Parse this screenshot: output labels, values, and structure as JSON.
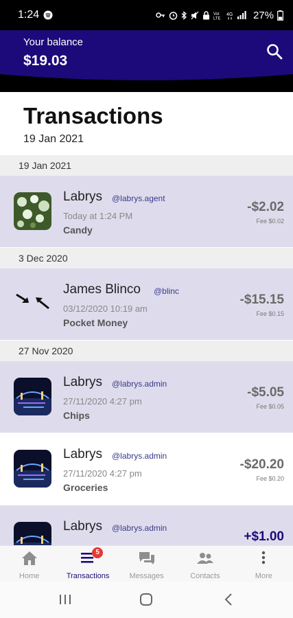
{
  "status": {
    "time": "1:24",
    "battery": "27%"
  },
  "header": {
    "balance_label": "Your balance",
    "balance_value": "$19.03",
    "search_icon": "search-icon"
  },
  "page": {
    "title": "Transactions",
    "date": "19 Jan 2021"
  },
  "sections": [
    {
      "date": "19 Jan 2021",
      "transactions": [
        {
          "name": "Labrys",
          "handle": "@labrys.agent",
          "time": "Today at 1:24 PM",
          "description": "Candy",
          "amount": "-$2.02",
          "fee": "Fee $0.02"
        }
      ]
    },
    {
      "date": "3 Dec 2020",
      "transactions": [
        {
          "name": "James Blinco",
          "handle": "@blinc",
          "time": "03/12/2020 10:19 am",
          "description": "Pocket Money",
          "amount": "-$15.15",
          "fee": "Fee $0.15"
        }
      ]
    },
    {
      "date": "27 Nov 2020",
      "transactions": [
        {
          "name": "Labrys",
          "handle": "@labrys.admin",
          "time": "27/11/2020 4:27 pm",
          "description": "Chips",
          "amount": "-$5.05",
          "fee": "Fee $0.05"
        },
        {
          "name": "Labrys",
          "handle": "@labrys.admin",
          "time": "27/11/2020 4:27 pm",
          "description": "Groceries",
          "amount": "-$20.20",
          "fee": "Fee $0.20"
        },
        {
          "name": "Labrys",
          "handle": "@labrys.admin",
          "time": "",
          "description": "",
          "amount": "+$1.00",
          "fee": ""
        }
      ]
    }
  ],
  "bottom_nav": {
    "items": [
      {
        "label": "Home",
        "icon": "home-icon"
      },
      {
        "label": "Transactions",
        "icon": "transactions-list-icon",
        "badge": "5"
      },
      {
        "label": "Messages",
        "icon": "messages-icon"
      },
      {
        "label": "Contacts",
        "icon": "contacts-icon"
      },
      {
        "label": "More",
        "icon": "more-vertical-icon"
      }
    ],
    "active": "Transactions"
  },
  "colors": {
    "brand": "#1c0a7a",
    "row_shaded": "#dedcec",
    "badge": "#e53935"
  }
}
